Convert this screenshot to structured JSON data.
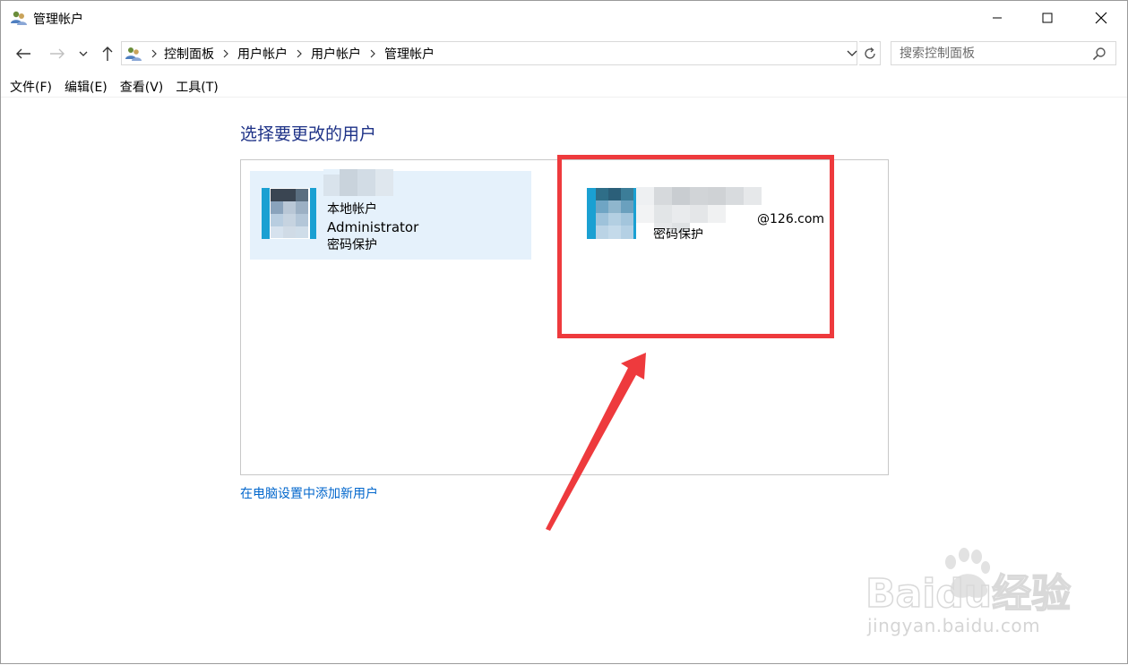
{
  "window": {
    "title": "管理帐户"
  },
  "address": {
    "crumbs": [
      "控制面板",
      "用户帐户",
      "用户帐户",
      "管理帐户"
    ]
  },
  "search": {
    "placeholder": "搜索控制面板"
  },
  "menu": [
    "文件(F)",
    "编辑(E)",
    "查看(V)",
    "工具(T)"
  ],
  "content": {
    "heading": "选择要更改的用户",
    "accounts": [
      {
        "type_line": "本地帐户",
        "name_line": "Administrator",
        "status_line": "密码保护"
      },
      {
        "email_suffix": "@126.com",
        "status_line": "密码保护"
      }
    ],
    "add_link": "在电脑设置中添加新用户"
  },
  "watermark": {
    "brand": "Baidu经验",
    "url": "jingyan.baidu.com"
  },
  "colors": {
    "heading": "#1e3287",
    "link": "#0066cc",
    "highlight": "#ee3a3d",
    "tile_selected": "#e5f1fb"
  }
}
